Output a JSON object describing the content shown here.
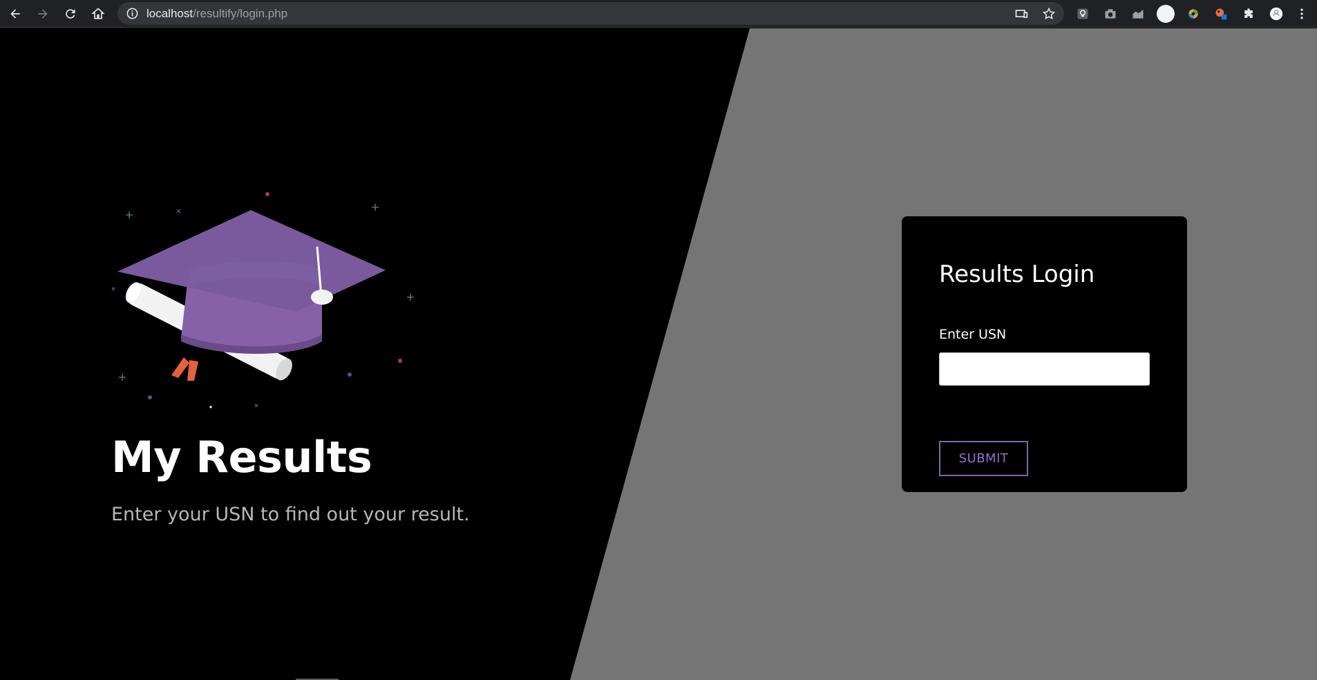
{
  "browser": {
    "url_host": "localhost",
    "url_path": "/resultify/login.php"
  },
  "hero": {
    "title": "My Results",
    "subtitle": "Enter your USN to find out your result."
  },
  "login": {
    "title": "Results Login",
    "usn_label": "Enter USN",
    "usn_value": "",
    "submit_label": "SUBMIT"
  },
  "colors": {
    "left_bg": "#000000",
    "right_bg": "#757575",
    "accent": "#8a5fb0",
    "cap_purple": "#7a5a9c"
  },
  "icons": [
    "back-arrow-icon",
    "forward-arrow-icon",
    "reload-icon",
    "home-icon",
    "info-icon",
    "cast-icon",
    "star-icon",
    "extensions-icon",
    "menu-icon",
    "graduation-cap-illustration"
  ]
}
